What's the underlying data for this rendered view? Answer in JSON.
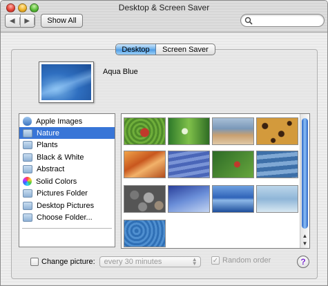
{
  "window": {
    "title": "Desktop & Screen Saver"
  },
  "toolbar": {
    "back_icon": "triangle-left",
    "forward_icon": "triangle-right",
    "show_all_label": "Show All",
    "search_placeholder": "",
    "search_value": ""
  },
  "tabs": [
    {
      "label": "Desktop",
      "selected": true
    },
    {
      "label": "Screen Saver",
      "selected": false
    }
  ],
  "current_picture": {
    "name": "Aqua Blue"
  },
  "sources": [
    {
      "label": "Apple Images",
      "icon": "apple-icon",
      "selected": false
    },
    {
      "label": "Nature",
      "icon": "folder-icon",
      "selected": true
    },
    {
      "label": "Plants",
      "icon": "folder-icon",
      "selected": false
    },
    {
      "label": "Black & White",
      "icon": "folder-icon",
      "selected": false
    },
    {
      "label": "Abstract",
      "icon": "folder-icon",
      "selected": false
    },
    {
      "label": "Solid Colors",
      "icon": "color-wheel-icon",
      "selected": false
    },
    {
      "label": "Pictures Folder",
      "icon": "pictures-folder-icon",
      "selected": false
    },
    {
      "label": "Desktop Pictures",
      "icon": "folder-icon",
      "selected": false
    },
    {
      "label": "Choose Folder...",
      "icon": "folder-icon",
      "selected": false
    }
  ],
  "thumbnails": [
    {
      "name": "ladybug-leaf-thumbnail"
    },
    {
      "name": "dew-drop-grass-thumbnail"
    },
    {
      "name": "shore-blur-thumbnail"
    },
    {
      "name": "leopard-fur-thumbnail"
    },
    {
      "name": "orange-canyon-thumbnail"
    },
    {
      "name": "blue-waves-thumbnail"
    },
    {
      "name": "ladybug-green-thumbnail"
    },
    {
      "name": "water-ripple-thumbnail"
    },
    {
      "name": "pebbles-thumbnail"
    },
    {
      "name": "blue-curve-thumbnail"
    },
    {
      "name": "ocean-horizon-thumbnail"
    },
    {
      "name": "pale-water-thumbnail"
    },
    {
      "name": "water-droplets-thumbnail"
    }
  ],
  "options": {
    "change_picture_label": "Change picture:",
    "change_picture_checked": false,
    "interval_value": "every 30 minutes",
    "random_order_label": "Random order",
    "random_order_checked": true,
    "help_label": "?"
  },
  "colors": {
    "selection": "#3875d7",
    "tab_selected": "#6aaee9"
  }
}
